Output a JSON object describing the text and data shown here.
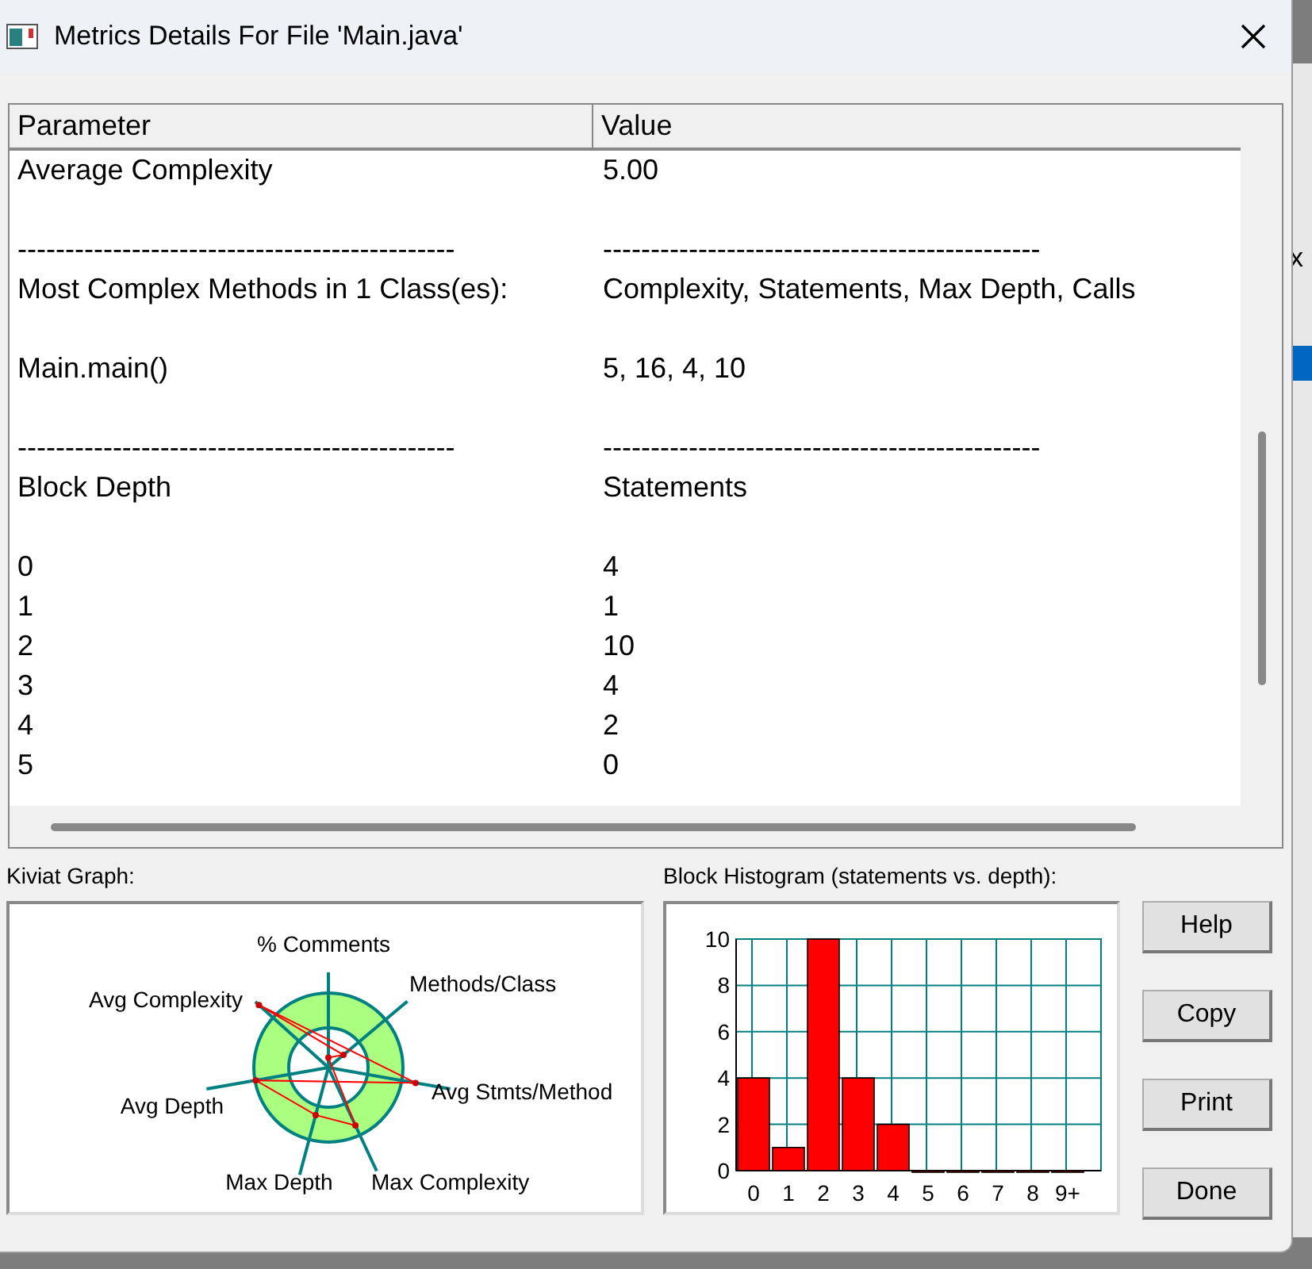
{
  "window": {
    "title": "Metrics Details For File 'Main.java'"
  },
  "table": {
    "columns": [
      "Parameter",
      "Value"
    ],
    "rows": [
      [
        "Average Complexity",
        "5.00"
      ],
      [
        "",
        ""
      ],
      [
        "----------------------------------------------",
        "----------------------------------------------"
      ],
      [
        "Most Complex Methods in 1 Class(es):",
        "Complexity, Statements, Max Depth, Calls"
      ],
      [
        "",
        ""
      ],
      [
        "Main.main()",
        "5, 16, 4, 10"
      ],
      [
        "",
        ""
      ],
      [
        "----------------------------------------------",
        "----------------------------------------------"
      ],
      [
        "Block Depth",
        "Statements"
      ],
      [
        "",
        ""
      ],
      [
        "0",
        "4"
      ],
      [
        "1",
        "1"
      ],
      [
        "2",
        "10"
      ],
      [
        "3",
        "4"
      ],
      [
        "4",
        "2"
      ],
      [
        "5",
        "0"
      ]
    ]
  },
  "kiviat": {
    "title": "Kiviat Graph:",
    "labels": [
      "% Comments",
      "Methods/Class",
      "Avg Complexity",
      "Avg Stmts/Method",
      "Avg Depth",
      "Max Depth",
      "Max Complexity"
    ]
  },
  "histogram": {
    "title": "Block Histogram (statements vs. depth):",
    "chart_data": {
      "type": "bar",
      "categories": [
        "0",
        "1",
        "2",
        "3",
        "4",
        "5",
        "6",
        "7",
        "8",
        "9+"
      ],
      "values": [
        4,
        1,
        10,
        4,
        2,
        0,
        0,
        0,
        0,
        0
      ],
      "ylim": [
        0,
        10
      ],
      "grid": true,
      "yticks": [
        0,
        2,
        4,
        6,
        8,
        10
      ]
    }
  },
  "buttons": [
    "Help",
    "Copy",
    "Print",
    "Done"
  ],
  "background_window": {
    "text": "x"
  }
}
